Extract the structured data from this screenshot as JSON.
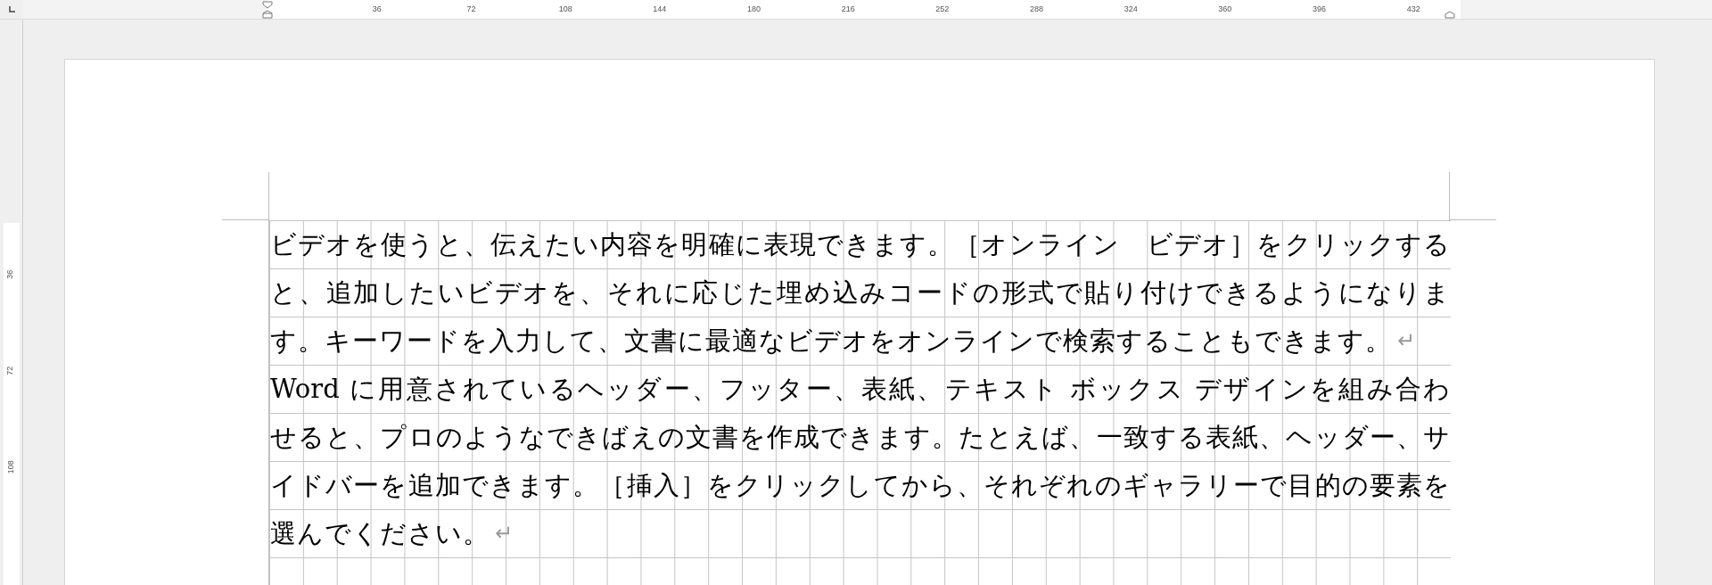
{
  "ruler": {
    "top_labels": [
      "36",
      "72",
      "108",
      "144",
      "180",
      "216",
      "252",
      "288",
      "324",
      "360",
      "396",
      "432"
    ],
    "left_labels": [
      "36",
      "72",
      "108"
    ]
  },
  "document": {
    "paragraphs": [
      {
        "lines": [
          "ビデオを使うと、伝えたい内容を明確に表現できます。［オンライン　ビデオ］をクリックする",
          "と、追加したいビデオを、それに応じた埋め込みコードの形式で貼り付けできるようになりま",
          "す。キーワードを入力して、文書に最適なビデオをオンラインで検索することもできます。"
        ],
        "end_mark": "↵"
      },
      {
        "lines": [
          "Word に用意されているヘッダー、フッター、表紙、テキスト ボックス デザインを組み合わ",
          "せると、プロのようなできばえの文書を作成できます。たとえば、一致する表紙、ヘッダー、サ",
          "イドバーを追加できます。［挿入］をクリックしてから、それぞれのギャラリーで目的の要素を",
          "選んでください。"
        ],
        "end_mark": "↵"
      }
    ]
  }
}
